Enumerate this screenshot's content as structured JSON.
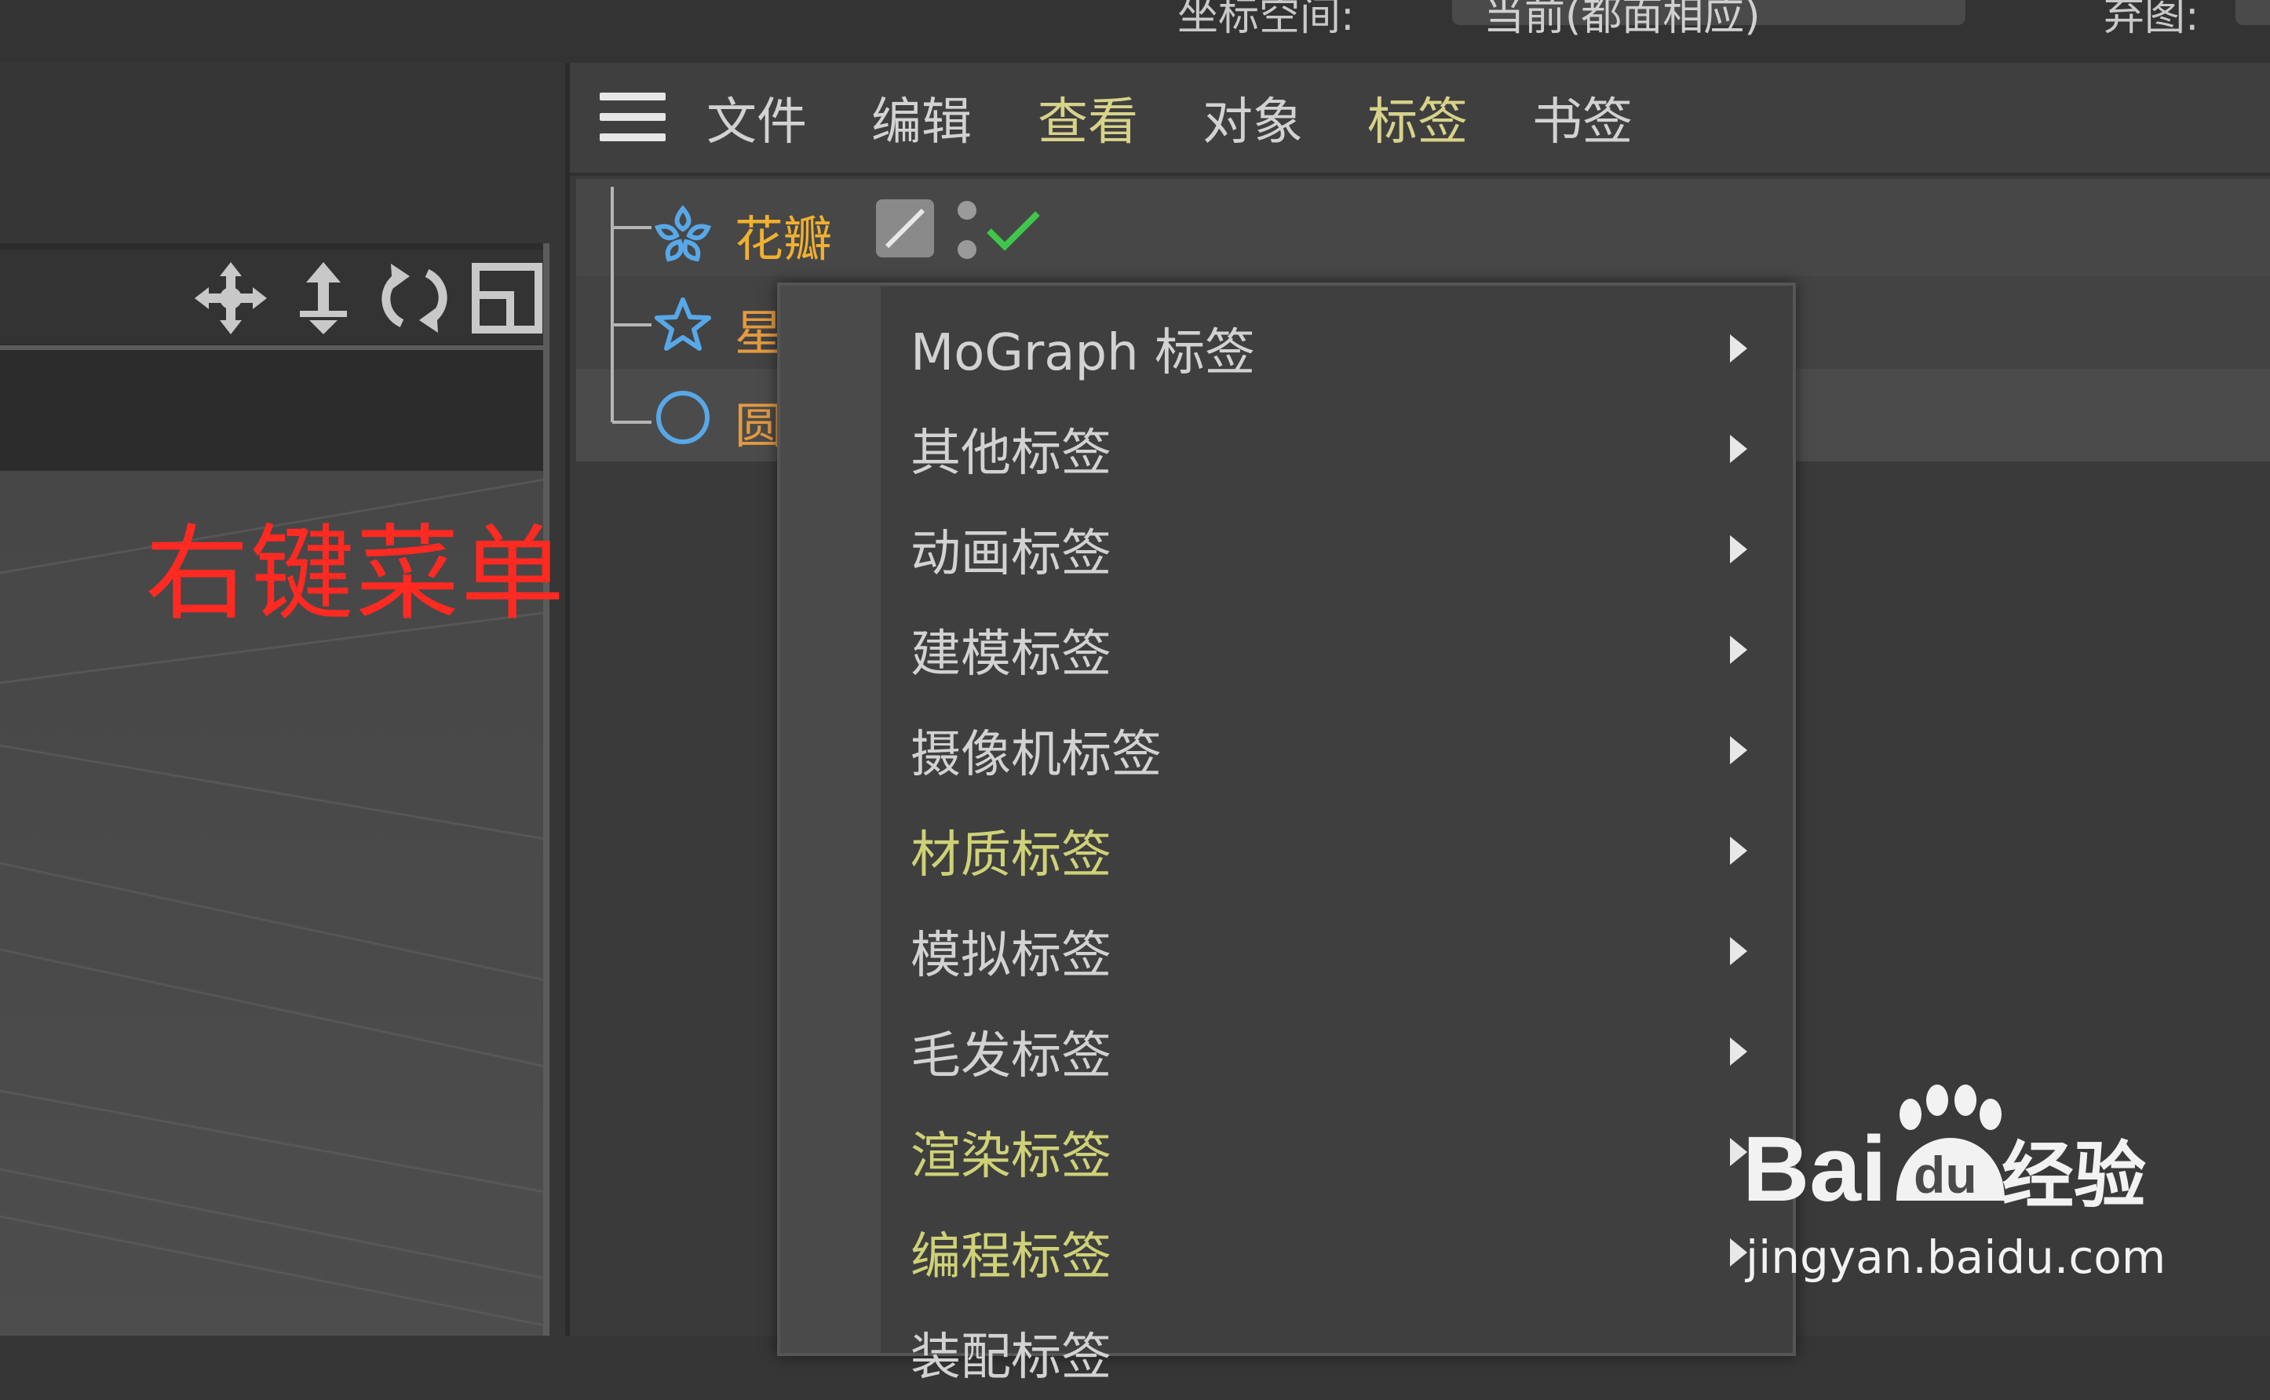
{
  "attribute_bar": {
    "label_left": "坐标空间:",
    "field_value": "当前(都面相应)",
    "label_right": "弃图:"
  },
  "menubar": {
    "items": [
      {
        "label": "文件",
        "highlight": false
      },
      {
        "label": "编辑",
        "highlight": false
      },
      {
        "label": "查看",
        "highlight": true
      },
      {
        "label": "对象",
        "highlight": false
      },
      {
        "label": "标签",
        "highlight": true
      },
      {
        "label": "书签",
        "highlight": false
      }
    ]
  },
  "objects": [
    {
      "name": "花瓣",
      "icon": "flower-icon",
      "color": "#f0b030"
    },
    {
      "name": "星",
      "icon": "star-icon",
      "color": "#e39a40"
    },
    {
      "name": "圆",
      "icon": "circle-icon",
      "color": "#e39a40"
    }
  ],
  "annotation": {
    "text": "右键菜单",
    "color": "#ff2a22"
  },
  "context_menu": {
    "items": [
      {
        "label": "MoGraph 标签",
        "highlight": false
      },
      {
        "label": "其他标签",
        "highlight": false
      },
      {
        "label": "动画标签",
        "highlight": false
      },
      {
        "label": "建模标签",
        "highlight": false
      },
      {
        "label": "摄像机标签",
        "highlight": false
      },
      {
        "label": "材质标签",
        "highlight": true
      },
      {
        "label": "模拟标签",
        "highlight": false
      },
      {
        "label": "毛发标签",
        "highlight": false
      },
      {
        "label": "渲染标签",
        "highlight": true
      },
      {
        "label": "编程标签",
        "highlight": true
      },
      {
        "label": "装配标签",
        "highlight": false
      }
    ]
  },
  "watermark": {
    "brand": "Bai",
    "brand2": "du",
    "cn": "经验",
    "url": "jingyan.baidu.com"
  }
}
